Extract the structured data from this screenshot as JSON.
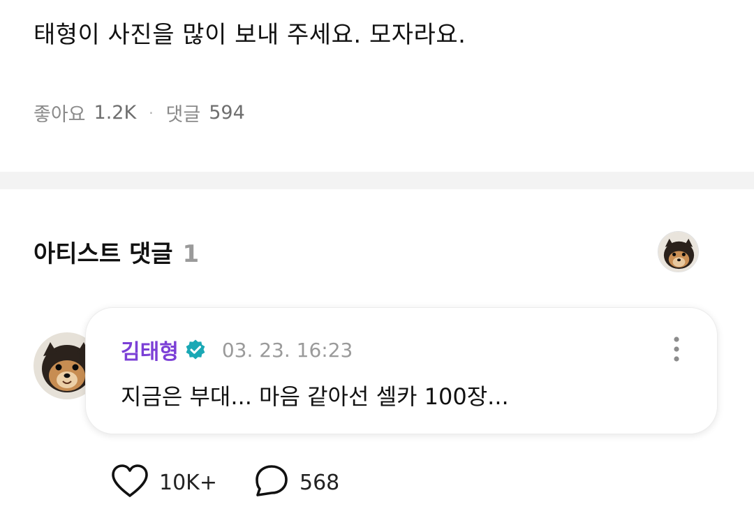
{
  "post": {
    "text": "태형이 사진을 많이 보내 주세요. 모자라요.",
    "likes_label": "좋아요",
    "likes_count": "1.2K",
    "comments_label": "댓글",
    "comments_count": "594",
    "separator": "·"
  },
  "artist_comments": {
    "title": "아티스트 댓글",
    "count": "1"
  },
  "comment": {
    "author": "김태형",
    "verified": true,
    "timestamp": "03. 23. 16:23",
    "text": "지금은 부대... 마음 같아선 셀카 100장...",
    "like_count": "10K+",
    "reply_count": "568"
  },
  "colors": {
    "author": "#7b3fd6",
    "verified_badge": "#1aa8b5",
    "muted_text": "#8a8a8a",
    "divider": "#f3f3f3"
  },
  "icons": {
    "verified": "verified-badge-icon",
    "more": "more-vertical-icon",
    "like": "heart-icon",
    "reply": "comment-bubble-icon"
  }
}
